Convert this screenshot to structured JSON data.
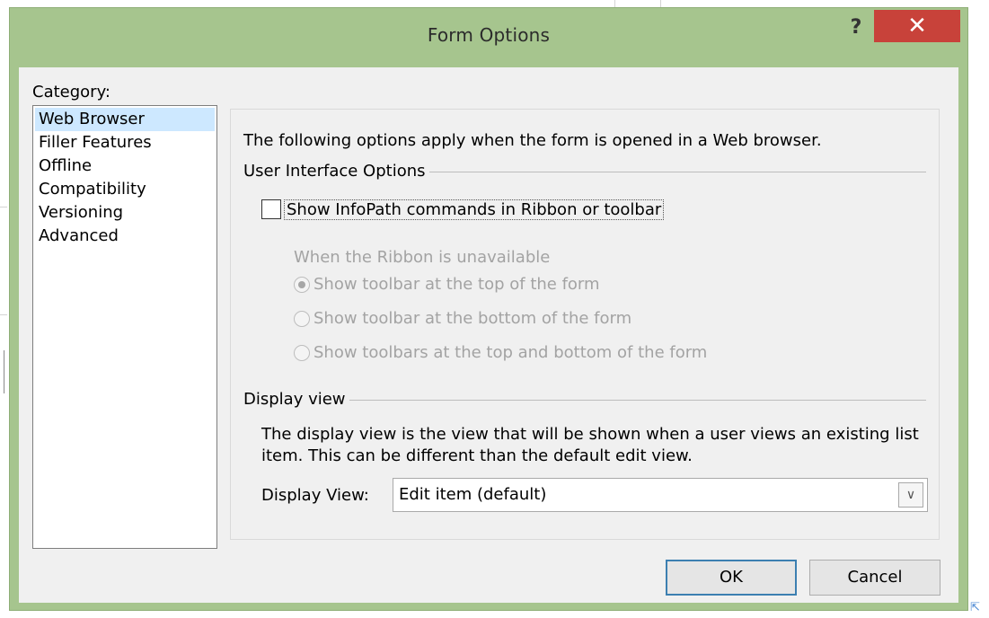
{
  "dialog": {
    "title": "Form Options",
    "help_label": "?",
    "close_label": "✕"
  },
  "category": {
    "label": "Category:",
    "items": [
      {
        "label": "Web Browser",
        "selected": true
      },
      {
        "label": "Filler Features"
      },
      {
        "label": "Offline"
      },
      {
        "label": "Compatibility"
      },
      {
        "label": "Versioning"
      },
      {
        "label": "Advanced"
      }
    ]
  },
  "panel": {
    "intro": "The following options apply when the form is opened in a Web browser.",
    "ui_options_header": "User Interface Options",
    "show_commands_label": "Show InfoPath commands in Ribbon or toolbar",
    "show_commands_checked": false,
    "ribbon_unavailable_label": "When the Ribbon is unavailable",
    "radio_options": [
      {
        "label": "Show toolbar at the top of the form",
        "checked": true,
        "enabled": false
      },
      {
        "label": "Show toolbar at the bottom of the form",
        "checked": false,
        "enabled": false
      },
      {
        "label": "Show toolbars at the top and bottom of the form",
        "checked": false,
        "enabled": false
      }
    ],
    "display_view_header": "Display view",
    "display_view_desc": "The display view is the view that will be shown when a user views an existing list item. This can be different than the default edit view.",
    "display_view_label": "Display View:",
    "display_view_value": "Edit item (default)",
    "dropdown_icon": "chevron-down-icon"
  },
  "buttons": {
    "ok_label": "OK",
    "cancel_label": "Cancel"
  }
}
